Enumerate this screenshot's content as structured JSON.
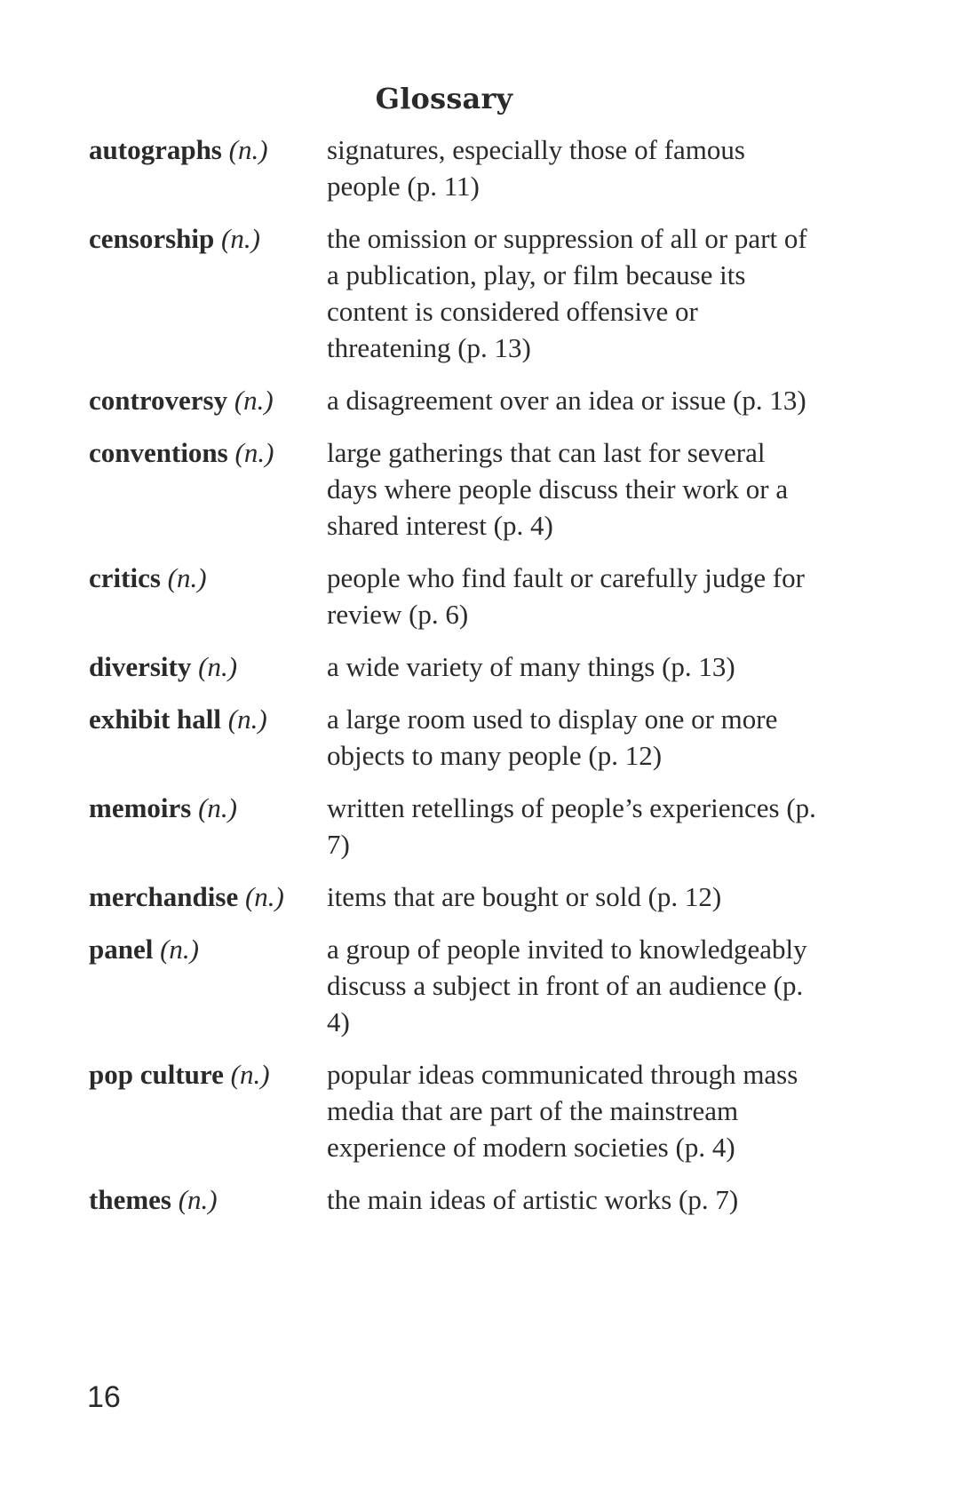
{
  "title": "Glossary",
  "entries": [
    {
      "term": "autographs",
      "pos": "(n.)",
      "definition": "signatures, especially those of famous people (p. 11)"
    },
    {
      "term": "censorship",
      "pos": "(n.)",
      "definition": "the omission or suppression of all or part of a publication, play, or film because its content is considered offensive or threatening (p. 13)"
    },
    {
      "term": "controversy",
      "pos": "(n.)",
      "definition": "a disagreement over an idea or issue (p. 13)"
    },
    {
      "term": "conventions",
      "pos": "(n.)",
      "definition": "large gatherings that can last for several days where people discuss their work or a shared interest (p. 4)"
    },
    {
      "term": "critics",
      "pos": "(n.)",
      "definition": "people who find fault or carefully judge for review (p. 6)"
    },
    {
      "term": "diversity",
      "pos": "(n.)",
      "definition": "a wide variety of many things (p. 13)"
    },
    {
      "term": "exhibit hall",
      "pos": "(n.)",
      "definition": "a large room used to display one or more objects to many people (p. 12)"
    },
    {
      "term": "memoirs",
      "pos": "(n.)",
      "definition": "written retellings of people’s experiences (p. 7)"
    },
    {
      "term": "merchandise",
      "pos": "(n.)",
      "definition": "items that are bought or sold (p. 12)"
    },
    {
      "term": "panel",
      "pos": "(n.)",
      "definition": "a group of people invited to knowledgeably discuss a subject in front of an audience (p. 4)"
    },
    {
      "term": "pop culture",
      "pos": "(n.)",
      "definition": "popular ideas communicated through mass media that are part of the mainstream experience of modern societies (p. 4)"
    },
    {
      "term": "themes",
      "pos": "(n.)",
      "definition": "the main ideas of artistic works (p. 7)"
    }
  ],
  "page_number": "16"
}
